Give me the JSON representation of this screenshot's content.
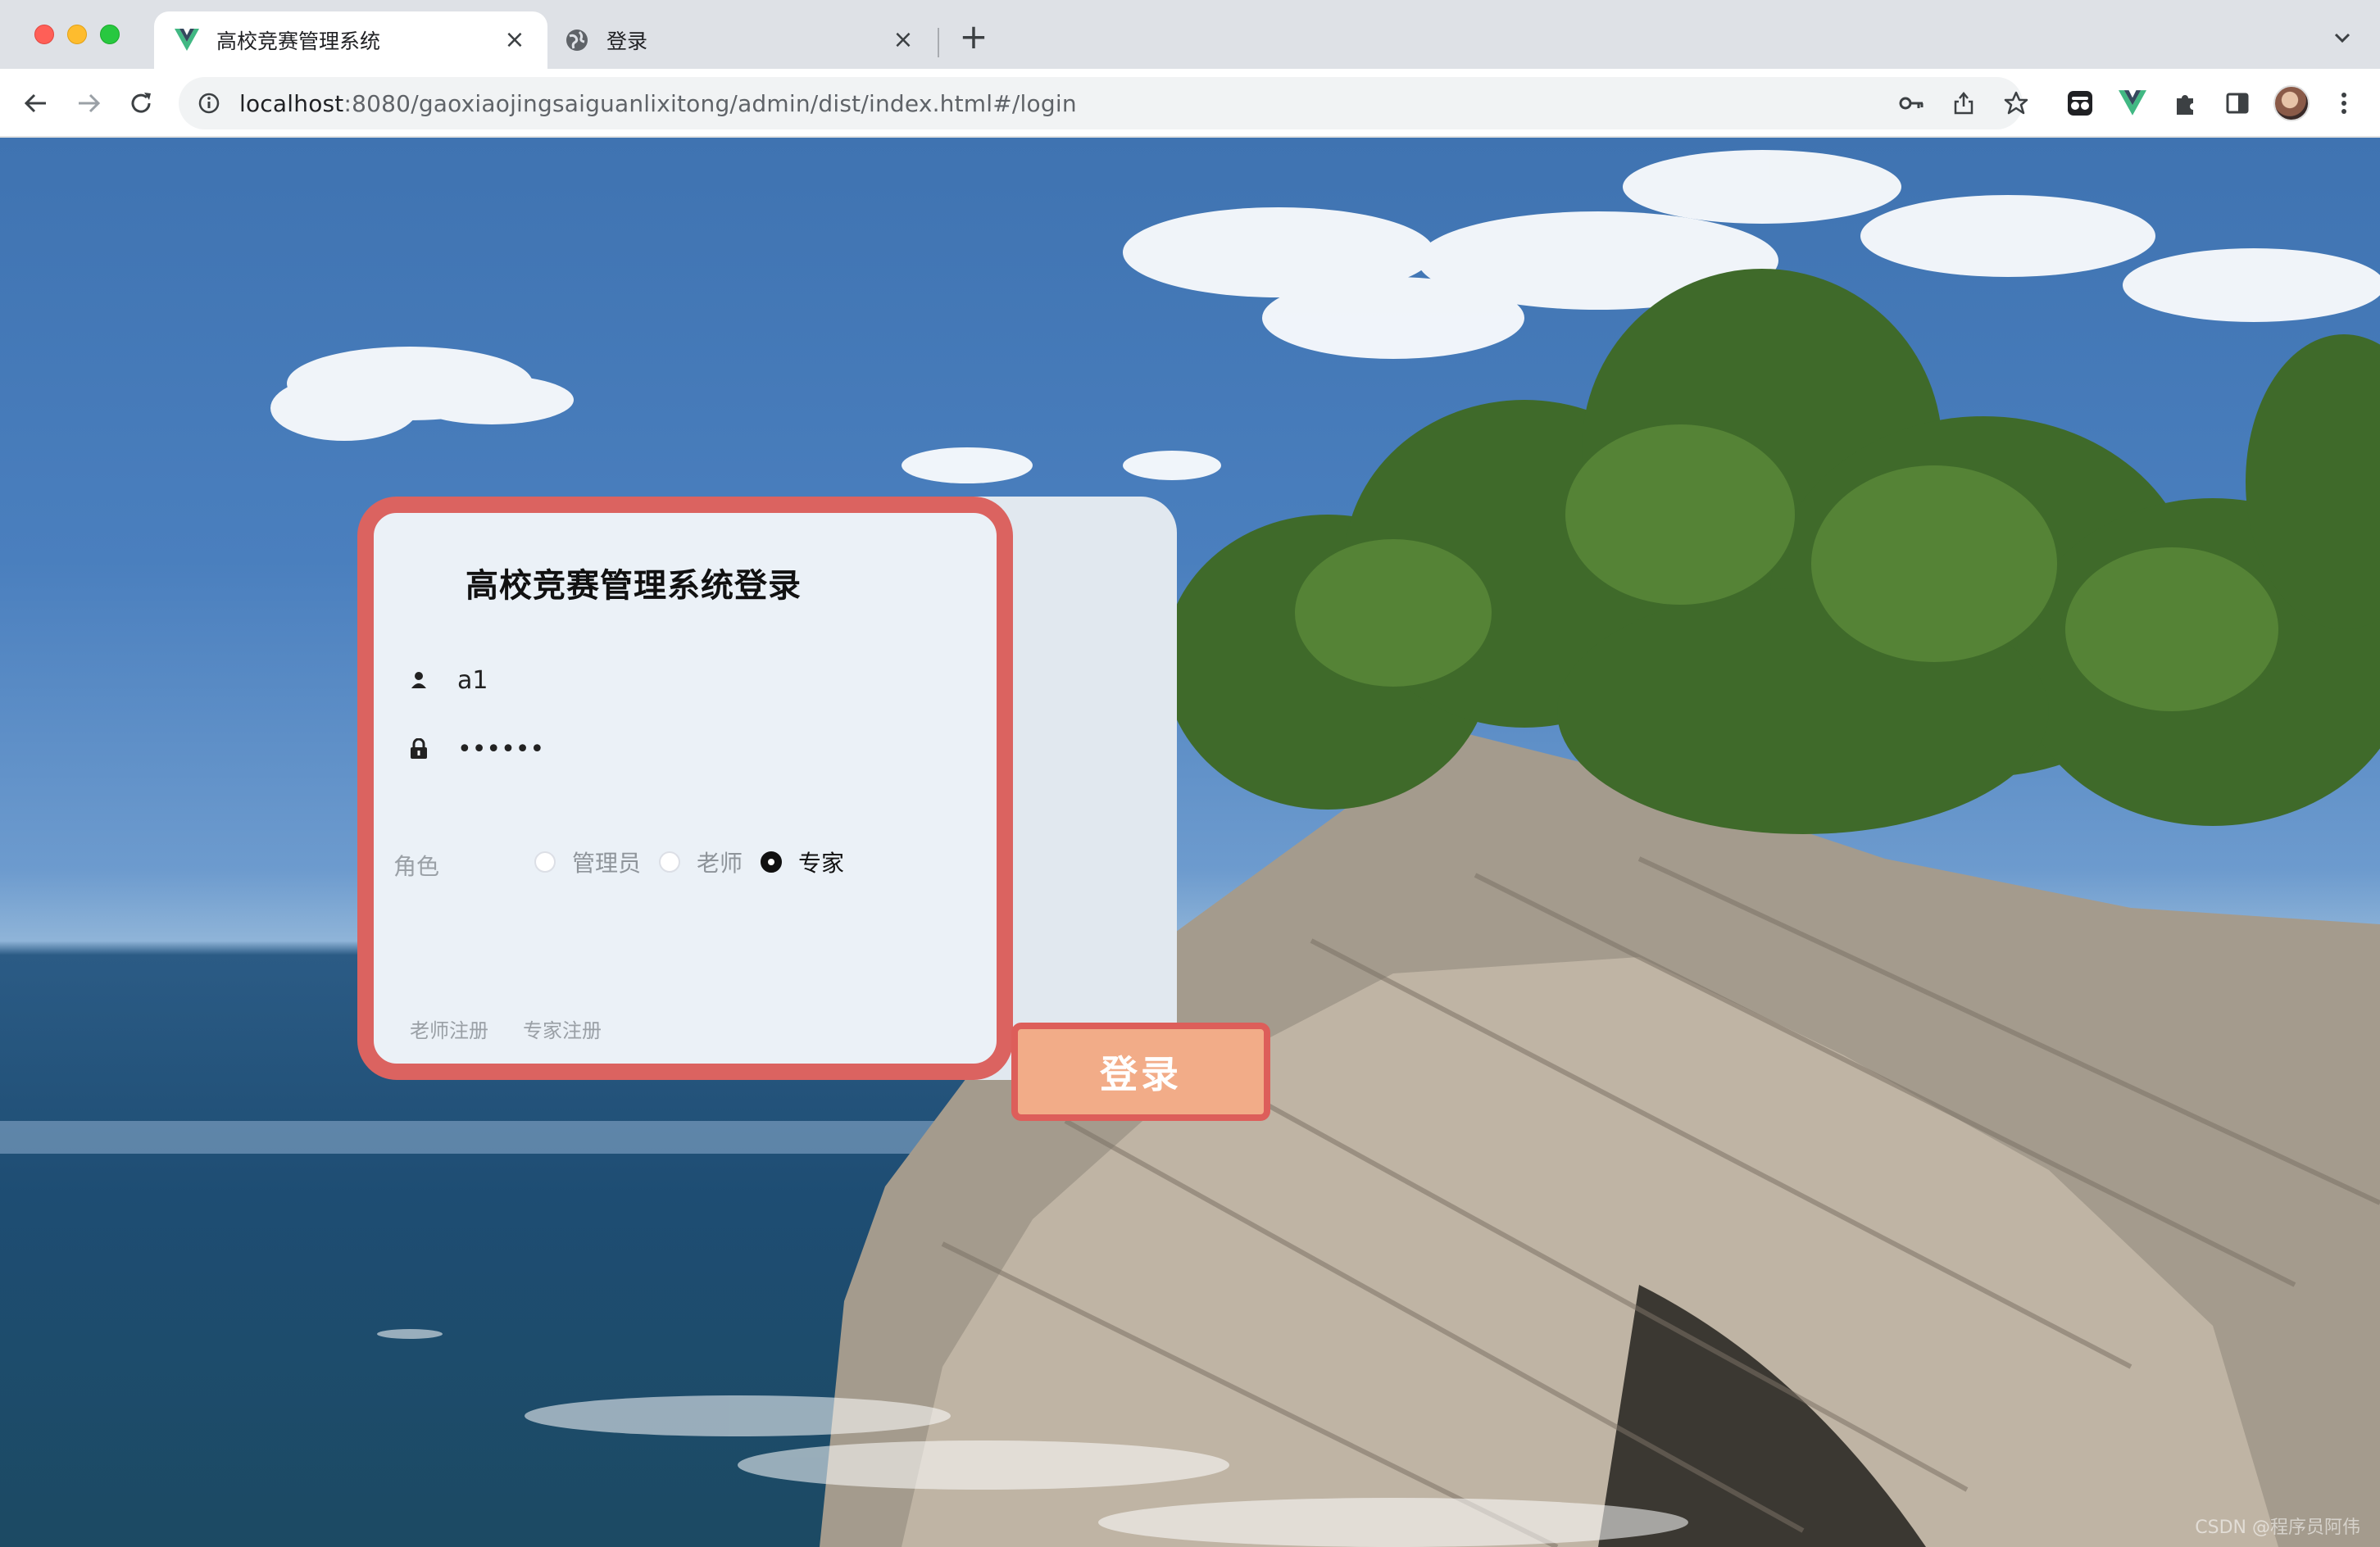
{
  "browser": {
    "tabs": [
      {
        "title": "高校竞赛管理系统",
        "icon": "vue-logo-icon",
        "active": true
      },
      {
        "title": "登录",
        "icon": "globe-icon",
        "active": false
      }
    ],
    "new_tab_label": "+",
    "close_label": "×",
    "url_host": "localhost",
    "url_rest": ":8080/gaoxiaojingsaiguanlixitong/admin/dist/index.html#/login"
  },
  "login": {
    "title": "高校竞赛管理系统登录",
    "username_value": "a1",
    "password_value": "123456",
    "role_label": "角色",
    "roles": [
      {
        "label": "管理员",
        "checked": false
      },
      {
        "label": "老师",
        "checked": false
      },
      {
        "label": "专家",
        "checked": true
      }
    ],
    "register_links": [
      "老师注册",
      "专家注册"
    ],
    "login_button": "登录"
  },
  "colors": {
    "card_border": "#db6360",
    "button_fill": "#f2ac88",
    "card_fill": "#ebf1f7"
  },
  "watermark": "CSDN @程序员阿伟"
}
